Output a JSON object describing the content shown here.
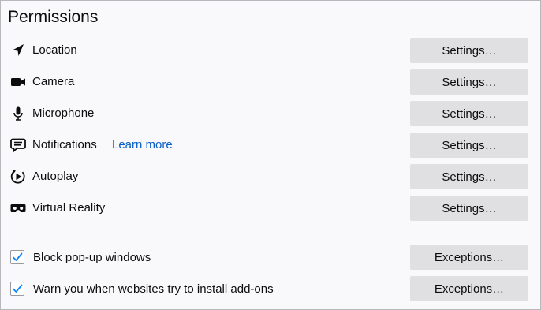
{
  "section": {
    "title": "Permissions"
  },
  "permissions": [
    {
      "label": "Location",
      "button": "Settings…",
      "icon": "location-arrow-icon"
    },
    {
      "label": "Camera",
      "button": "Settings…",
      "icon": "camera-icon"
    },
    {
      "label": "Microphone",
      "button": "Settings…",
      "icon": "microphone-icon"
    },
    {
      "label": "Notifications",
      "link": "Learn more",
      "button": "Settings…",
      "icon": "notification-bubble-icon"
    },
    {
      "label": "Autoplay",
      "button": "Settings…",
      "icon": "autoplay-icon"
    },
    {
      "label": "Virtual Reality",
      "button": "Settings…",
      "icon": "vr-headset-icon"
    }
  ],
  "options": [
    {
      "label": "Block pop-up windows",
      "checked": true,
      "button": "Exceptions…"
    },
    {
      "label": "Warn you when websites try to install add-ons",
      "checked": true,
      "button": "Exceptions…"
    }
  ],
  "colors": {
    "link": "#0a5fc8",
    "button_bg": "#e0e0e2",
    "check": "#0a84ff"
  }
}
